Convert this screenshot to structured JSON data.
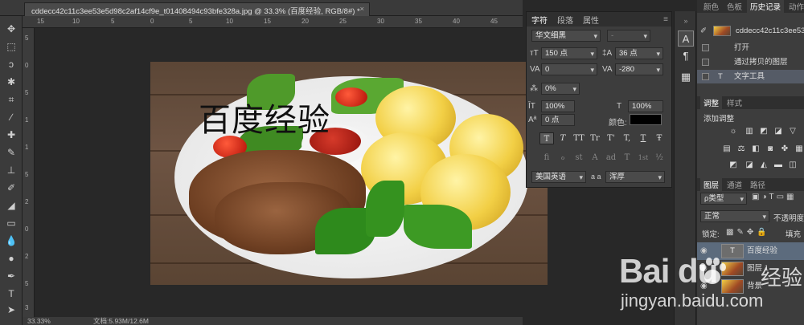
{
  "document_tab": {
    "title": "cddecc42c11c3ee53e5d98c2af14cf9e_t01408494c93bfe328a.jpg @ 33.3% (百度经验, RGB/8#) *",
    "close": "×"
  },
  "ruler": {
    "h_ticks": [
      "15",
      "10",
      "5",
      "0",
      "5",
      "10",
      "15",
      "20",
      "25",
      "30",
      "35",
      "40",
      "45"
    ],
    "v_ticks": [
      "5",
      "0",
      "5",
      "1",
      "1",
      "5",
      "2",
      "0",
      "2",
      "5",
      "3"
    ]
  },
  "canvas": {
    "overlay_text": "百度经验"
  },
  "status_bar": {
    "zoom": "33.33%",
    "doc_info": "文档:5.93M/12.6M"
  },
  "character_panel": {
    "tabs": [
      "字符",
      "段落",
      "属性"
    ],
    "active_tab": "字符",
    "font_family": "华文细黑",
    "font_style": "-",
    "font_size": "150 点",
    "leading": "36 点",
    "kerning": "0",
    "tracking": "-280",
    "scale_percent": "0%",
    "vertical_scale": "100%",
    "horizontal_scale": "100%",
    "baseline_shift": "0 点",
    "color_label": "颜色:",
    "color_value": "#000000",
    "typo_buttons": [
      "T",
      "T",
      "TT",
      "Tr",
      "T'",
      "T,",
      "T",
      "Ŧ"
    ],
    "opentype_buttons": [
      "fi",
      "ℴ",
      "st",
      "A",
      "ad",
      "T",
      "1st",
      "½"
    ],
    "language": "美国英语",
    "aa_label": "a a",
    "antialias": "浑厚"
  },
  "history_panel": {
    "tabs": [
      "颜色",
      "色板",
      "历史记录",
      "动作"
    ],
    "active_tab": "历史记录",
    "snapshot_name": "cddecc42c11c3ee53e5d",
    "items": [
      "打开",
      "通过拷贝的图层",
      "文字工具"
    ]
  },
  "adjustments_panel": {
    "tabs": [
      "调整",
      "样式"
    ],
    "active_tab": "调整",
    "add_label": "添加调整"
  },
  "layers_panel": {
    "tabs": [
      "图层",
      "通道",
      "路径"
    ],
    "active_tab": "图层",
    "filter_kind": "ρ类型",
    "blend_mode": "正常",
    "opacity_label": "不透明度",
    "lock_label": "锁定:",
    "fill_label": "填充",
    "layers": [
      {
        "name": "百度经验",
        "type": "text",
        "selected": true
      },
      {
        "name": "图层 1",
        "type": "image",
        "selected": false
      },
      {
        "name": "背景",
        "type": "image",
        "selected": false
      }
    ]
  },
  "watermark": {
    "brand": "Bai  du",
    "brand_cn": "经验",
    "url": "jingyan.baidu.com"
  },
  "colors": {
    "selection": "#5c6b7d",
    "panel_bg": "#3d3d3d",
    "app_bg": "#282828"
  }
}
